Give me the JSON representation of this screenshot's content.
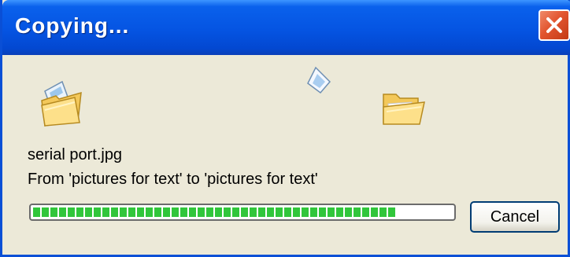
{
  "window": {
    "title": "Copying...",
    "close_icon": "close-icon"
  },
  "animation": {
    "source_icon": "open-folder-icon",
    "flying_icon": "flying-document-icon",
    "target_icon": "open-folder-icon"
  },
  "details": {
    "filename": "serial port.jpg",
    "from_to": "From 'pictures for text' to 'pictures for text'"
  },
  "progress": {
    "fraction": 0.86
  },
  "buttons": {
    "cancel_label": "Cancel"
  },
  "colors": {
    "titlebar": "#0554e2",
    "progress_fill": "#31c63b",
    "close_button": "#e2552f",
    "dialog_background": "#ece9d8"
  }
}
